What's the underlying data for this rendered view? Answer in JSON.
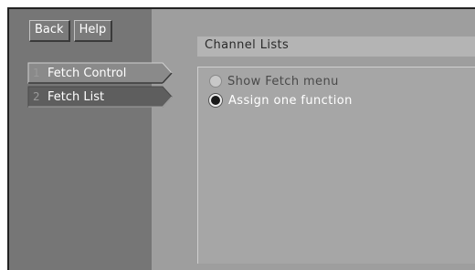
{
  "header": {
    "back_label": "Back",
    "help_label": "Help"
  },
  "steps": [
    {
      "number": "1",
      "label": "Fetch Control",
      "active": true
    },
    {
      "number": "2",
      "label": "Fetch List",
      "active": false
    }
  ],
  "main": {
    "title": "Channel Lists",
    "options": [
      {
        "label": "Show Fetch menu",
        "selected": false
      },
      {
        "label": "Assign one function",
        "selected": true
      }
    ]
  },
  "colors": {
    "sidebar": "#767676",
    "content": "#9e9e9e",
    "panel": "#a6a6a6"
  }
}
